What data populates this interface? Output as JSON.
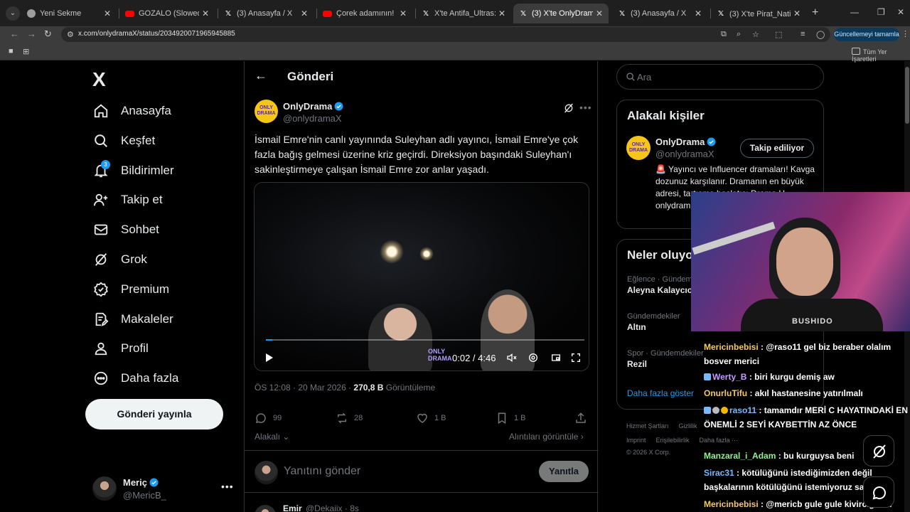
{
  "browser": {
    "tabs": [
      {
        "title": "Yeni Sekme",
        "favicon": "chrome-icon",
        "active": false
      },
      {
        "title": "GOZALO (Slowed) - YouTube",
        "favicon": "youtube-icon",
        "active": false
      },
      {
        "title": "(3) Anasayfa / X",
        "favicon": "x-icon",
        "active": false
      },
      {
        "title": "Çorek adamının! | Shrek 1",
        "favicon": "youtube-icon",
        "active": false
      },
      {
        "title": "X'te Antifa_Ultras: \"Ma",
        "favicon": "x-icon",
        "active": false
      },
      {
        "title": "(3) X'te OnlyDrama: \"İsma",
        "favicon": "x-icon",
        "active": true
      },
      {
        "title": "(3) Anasayfa / X",
        "favicon": "x-icon",
        "active": false
      },
      {
        "title": "(3) X'te Pirat_Nation 🔴 ",
        "favicon": "x-icon",
        "active": false
      }
    ],
    "url": "x.com/onlydramaX/status/2034920071965945885",
    "update_button": "Güncellemeyi tamamla",
    "all_bookmarks": "Tüm Yer İşaretleri"
  },
  "sidebar": {
    "logo": "X",
    "items": [
      {
        "label": "Anasayfa",
        "icon": "home-icon"
      },
      {
        "label": "Keşfet",
        "icon": "search-icon"
      },
      {
        "label": "Bildirimler",
        "icon": "bell-icon",
        "badge": "3"
      },
      {
        "label": "Takip et",
        "icon": "follow-icon"
      },
      {
        "label": "Sohbet",
        "icon": "mail-icon"
      },
      {
        "label": "Grok",
        "icon": "grok-icon"
      },
      {
        "label": "Premium",
        "icon": "premium-icon"
      },
      {
        "label": "Makaleler",
        "icon": "article-icon"
      },
      {
        "label": "Profil",
        "icon": "profile-icon"
      },
      {
        "label": "Daha fazla",
        "icon": "more-icon"
      }
    ],
    "post_button": "Gönderi yayınla",
    "account": {
      "name": "Meriç",
      "handle": "@MericB_"
    }
  },
  "main": {
    "title": "Gönderi",
    "post": {
      "author_name": "OnlyDrama",
      "author_handle": "@onlydramaX",
      "avatar_text_1": "ONLY",
      "avatar_text_2": "DRAMA",
      "text": "İsmail Emre'nin canlı yayınında Suleyhan adlı yayıncı, İsmail Emre'ye çok fazla bağış gelmesi üzerine kriz geçirdi. Direksiyon başındaki Suleyhan'ı sakinleştirmeye çalışan İsmail Emre zor anlar yaşadı.",
      "video": {
        "time": "0:02 / 4:46",
        "progress": 0.007,
        "watermark_1": "ONLY",
        "watermark_2": "DRAMA"
      },
      "timestamp": "ÖS 12:08 · 20 Mar 2026 · ",
      "views_count": "270,8 B",
      "views_label": " Görüntüleme",
      "replies": "99",
      "reposts": "28",
      "likes": "1 B",
      "bookmarks": "1 B"
    },
    "relevance": "Alakalı",
    "quotes_link": "Alıntıları görüntüle",
    "reply_placeholder": "Yanıtını gönder",
    "reply_button": "Yanıtla",
    "next_post": {
      "name": "Emir",
      "handle": "@Dekaiix · 8s"
    }
  },
  "right": {
    "search_placeholder": "Ara",
    "relevant_title": "Alakalı kişiler",
    "person": {
      "name": "OnlyDrama",
      "handle": "@onlydramaX",
      "follow_label": "Takip ediliyor",
      "bio": "🚨 Yayıncı ve Influencer dramaları! Kavga dozunuz karşılanır. Dramanın en büyük adresi, tartışma başlatıcı Drama H... onlydram..."
    },
    "trends_title": "Neler oluyor",
    "trends": [
      {
        "category": "Eğlence · Gündemde",
        "name": "Aleyna Kalaycıo"
      },
      {
        "category": "Gündemdekiler",
        "name": "Altın"
      },
      {
        "category": "Spor · Gündemdekiler",
        "name": "Rezil"
      }
    ],
    "show_more": "Daha fazla göster",
    "footer_row1": [
      "Hizmet Şartları",
      "Gizlilik"
    ],
    "footer_row2": [
      "Imprint",
      "Erişilebilirlik",
      "Daha fazla ···"
    ],
    "copyright": "© 2026 X Corp."
  },
  "stream": {
    "shirt_text": "BUSHIDO",
    "chat": [
      {
        "user": "Mericinbebisi",
        "color": "#f5c86a",
        "text": ": @raso11 gel biz beraber olalım bosver merici"
      },
      {
        "user": "Werty_B",
        "color": "#c79bff",
        "text": ": biri kurgu demiş aw"
      },
      {
        "user": "OnurluTifu",
        "color": "#f5c86a",
        "text": ": akıl hastanesine yatırılmalı"
      },
      {
        "user": "raso11",
        "color": "#7ab8ff",
        "text": ": tamamdır MERİ C HAYATINDAKİ EN ÖNEMLİ 2 SEYİ KAYBETTİN AZ ÖNCE"
      },
      {
        "user": "Manzaral_i_Adam",
        "color": "#8cf58c",
        "text": ": bu kurguysa beni"
      },
      {
        "user": "Sirac31",
        "color": "#7ab8ff",
        "text": ": kötülüğünü istediğimizden değil başkalarının kötülüğünü istemiyoruz sadece"
      },
      {
        "user": "Mericinbebisi",
        "color": "#f5c86a",
        "text": ": @mericb gule gule kivircigimm"
      }
    ]
  },
  "colors": {
    "accent": "#1d9bf0",
    "background": "#000000",
    "border": "#2f3336",
    "muted": "#71767b"
  }
}
